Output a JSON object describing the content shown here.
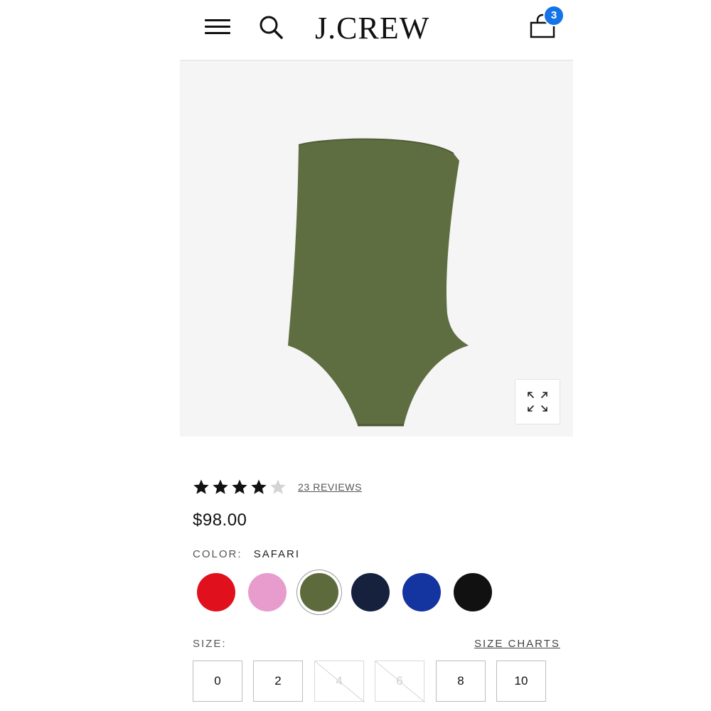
{
  "header": {
    "logo": "J.CREW",
    "menu_icon": "hamburger-menu-icon",
    "search_icon": "search-icon",
    "bag_icon": "shopping-bag-icon",
    "bag_count": "3",
    "badge_color": "#1473e6"
  },
  "product": {
    "image_description_icon": "swimsuit-image",
    "expand_icon": "expand-arrows-icon",
    "rating": {
      "stars_filled": 4,
      "stars_total": 5,
      "reviews_label": "23 REVIEWS"
    },
    "price": "$98.00",
    "color": {
      "label": "COLOR:",
      "value": "SAFARI",
      "swatches": [
        {
          "name": "red",
          "hex": "#e0101c"
        },
        {
          "name": "pink",
          "hex": "#e79ccd"
        },
        {
          "name": "safari",
          "hex": "#5d6b3c",
          "selected": true
        },
        {
          "name": "navy",
          "hex": "#15213d"
        },
        {
          "name": "blue",
          "hex": "#1434a0"
        },
        {
          "name": "black",
          "hex": "#111111"
        }
      ]
    },
    "size": {
      "label": "SIZE:",
      "charts_label": "SIZE CHARTS",
      "options": [
        {
          "label": "0",
          "available": true
        },
        {
          "label": "2",
          "available": true
        },
        {
          "label": "4",
          "available": false
        },
        {
          "label": "6",
          "available": false
        },
        {
          "label": "8",
          "available": true
        },
        {
          "label": "10",
          "available": true
        }
      ]
    }
  }
}
